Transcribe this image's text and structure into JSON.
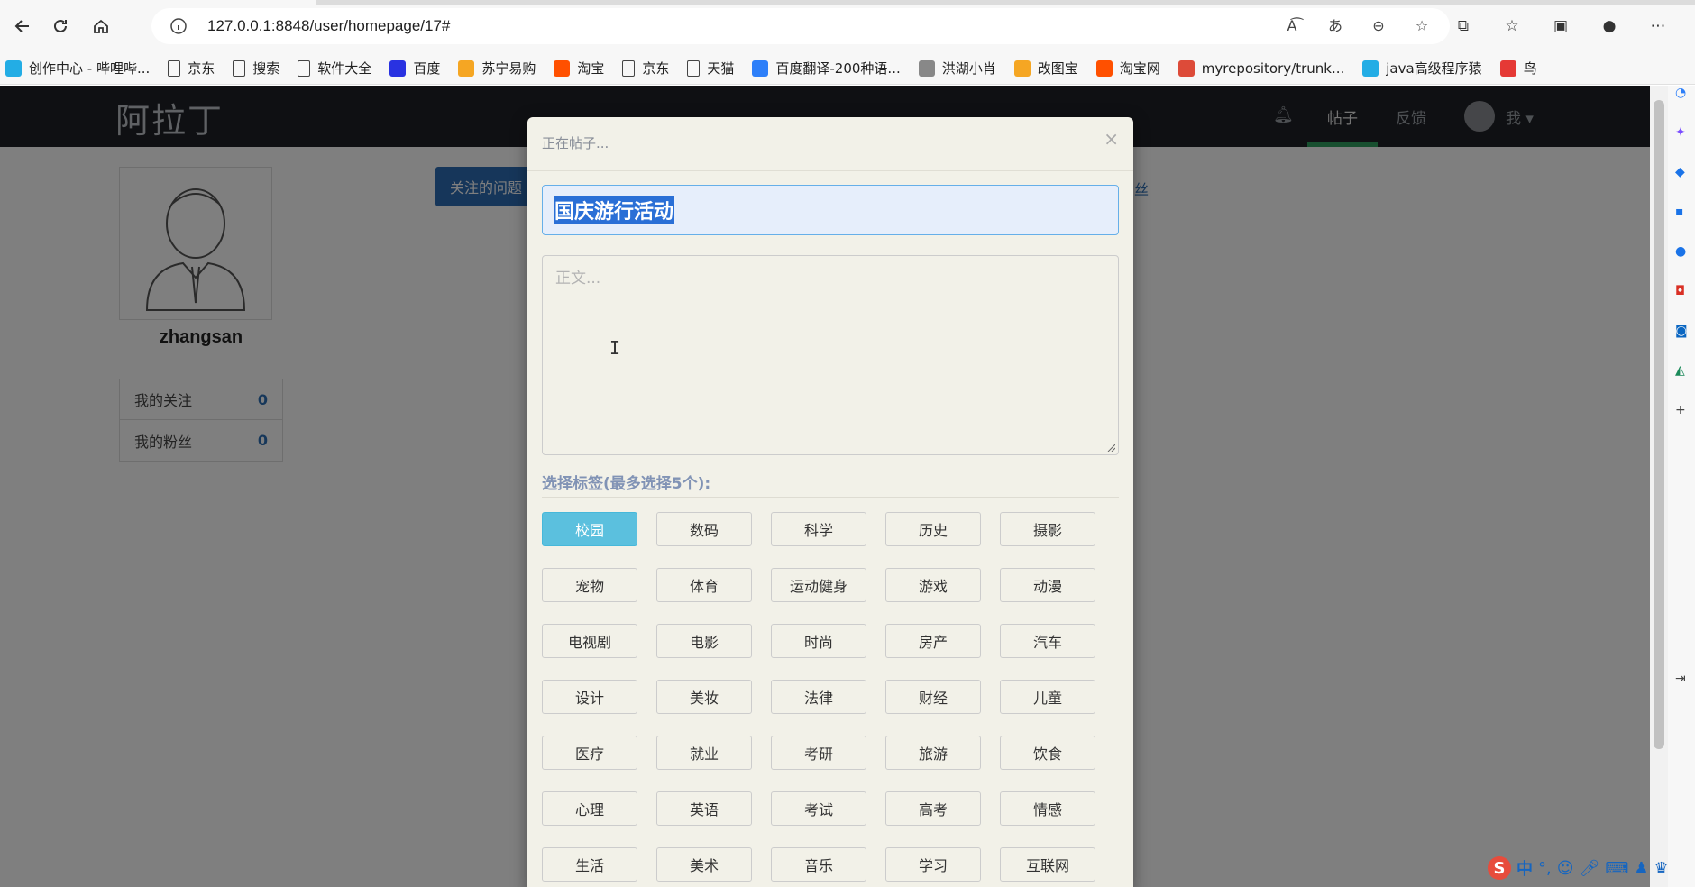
{
  "browser": {
    "url": "127.0.0.1:8848/user/homepage/17#",
    "bookmarks": [
      {
        "label": "创作中心 - 哔哩哔...",
        "icon": "bilibili-icon",
        "color": "#23ade5"
      },
      {
        "label": "京东",
        "icon": "page-icon",
        "color": ""
      },
      {
        "label": "搜索",
        "icon": "page-icon",
        "color": ""
      },
      {
        "label": "软件大全",
        "icon": "page-icon",
        "color": ""
      },
      {
        "label": "百度",
        "icon": "baidu-paw-icon",
        "color": "#2932e1"
      },
      {
        "label": "苏宁易购",
        "icon": "suning-icon",
        "color": "#f5a623"
      },
      {
        "label": "淘宝",
        "icon": "taobao-icon",
        "color": "#ff5000"
      },
      {
        "label": "京东",
        "icon": "page-icon",
        "color": ""
      },
      {
        "label": "天猫",
        "icon": "page-icon",
        "color": ""
      },
      {
        "label": "百度翻译-200种语...",
        "icon": "translate-icon",
        "color": "#2d7ff9"
      },
      {
        "label": "洪湖小肖",
        "icon": "bird-icon",
        "color": "#888888"
      },
      {
        "label": "改图宝",
        "icon": "gaitubao-icon",
        "color": "#f5a623"
      },
      {
        "label": "淘宝网",
        "icon": "taobao-icon",
        "color": "#ff5000"
      },
      {
        "label": "myrepository/trunk...",
        "icon": "chrome-icon",
        "color": "#dd4b39"
      },
      {
        "label": "java高级程序猿",
        "icon": "bilibili-icon",
        "color": "#23ade5"
      },
      {
        "label": "鸟",
        "icon": "bird-icon",
        "color": "#e53935"
      }
    ]
  },
  "site": {
    "logo": "阿拉丁",
    "nav": {
      "posts": "帖子",
      "feedback": "反馈",
      "me": "我"
    },
    "username": "zhangsan",
    "stats": [
      {
        "label": "我的关注",
        "value": "0"
      },
      {
        "label": "我的粉丝",
        "value": "0"
      }
    ],
    "follow_button": "关注的问题",
    "partial_link": "丝"
  },
  "modal": {
    "title": "正在帖子...",
    "close": "×",
    "title_value": "国庆游行活动",
    "body_placeholder": "正文...",
    "tag_label": "选择标签(最多选择5个):",
    "tags": [
      "校园",
      "数码",
      "科学",
      "历史",
      "摄影",
      "宠物",
      "体育",
      "运动健身",
      "游戏",
      "动漫",
      "电视剧",
      "电影",
      "时尚",
      "房产",
      "汽车",
      "设计",
      "美妆",
      "法律",
      "财经",
      "儿童",
      "医疗",
      "就业",
      "考研",
      "旅游",
      "饮食",
      "心理",
      "英语",
      "考试",
      "高考",
      "情感",
      "生活",
      "美术",
      "音乐",
      "学习",
      "互联网"
    ],
    "active_tag": "校园"
  },
  "ime": {
    "lang": "中"
  },
  "colors": {
    "accent": "#2d6cb5",
    "active_tag": "#5bc0de",
    "nav_bg": "#1f2126",
    "nav_active": "#2e9e5e"
  }
}
